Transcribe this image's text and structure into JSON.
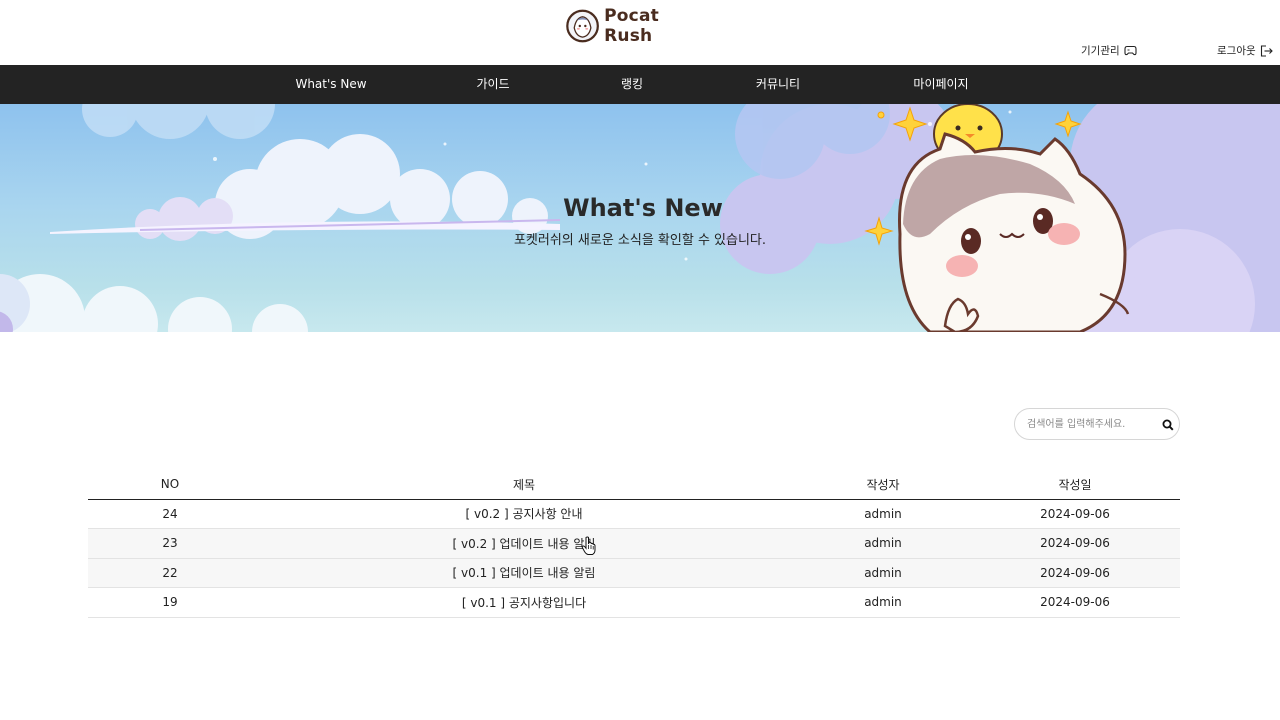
{
  "header": {
    "logo_text": "Pocat Rush",
    "device_label": "기기관리",
    "logout_label": "로그아웃"
  },
  "nav": {
    "items": [
      {
        "label": "What's New"
      },
      {
        "label": "가이드"
      },
      {
        "label": "랭킹"
      },
      {
        "label": "커뮤니티"
      },
      {
        "label": "마이페이지"
      }
    ]
  },
  "hero": {
    "title": "What's New",
    "subtitle": "포켓러쉬의 새로운 소식을 확인할 수 있습니다."
  },
  "search": {
    "placeholder": "검색어를 입력해주세요."
  },
  "board": {
    "headers": {
      "no": "NO",
      "title": "제목",
      "writer": "작성자",
      "date": "작성일"
    },
    "rows": [
      {
        "no": "24",
        "title": "[ v0.2 ] 공지사항 안내",
        "writer": "admin",
        "date": "2024-09-06"
      },
      {
        "no": "23",
        "title": "[ v0.2 ] 업데이트 내용 알림",
        "writer": "admin",
        "date": "2024-09-06"
      },
      {
        "no": "22",
        "title": "[ v0.1 ] 업데이트 내용 알림",
        "writer": "admin",
        "date": "2024-09-06"
      },
      {
        "no": "19",
        "title": "[ v0.1 ] 공지사항입니다",
        "writer": "admin",
        "date": "2024-09-06"
      }
    ]
  },
  "icons": {
    "device": "gamepad-icon",
    "logout": "logout-icon",
    "search": "search-icon",
    "cursor": "hand-pointer-icon"
  },
  "colors": {
    "nav_bg": "#232323",
    "logo_brown": "#4a2c1f",
    "sky_top": "#8ec2ee",
    "sky_bottom": "#c7e8ee"
  }
}
